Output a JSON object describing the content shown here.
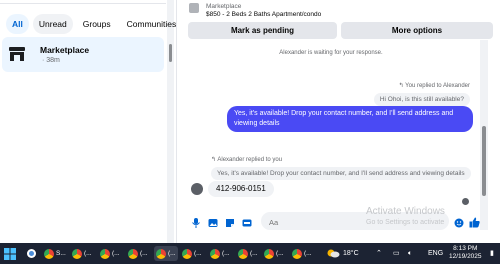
{
  "filters": [
    "All",
    "Unread",
    "Groups",
    "Communities"
  ],
  "chat_list": [
    {
      "title": "Marketplace",
      "subtitle": "· 38m"
    }
  ],
  "conversation": {
    "item_label": "Marketplace",
    "item_title": "$850 - 2 Beds 2 Baths Apartment/condo",
    "buttons": {
      "pending": "Mark as pending",
      "more": "More options"
    },
    "waiting_text": "Alexander is waiting for your response.",
    "reply_header_right": "You replied to Alexander",
    "quoted_right": "Hi Ohoi, is this still available?",
    "sent_message": "Yes, it's available! Drop your contact number, and I'll send address and viewing details",
    "reply_header_left": "Alexander replied to you",
    "quoted_left": "Yes, it's available! Drop your contact number, and I'll send address and viewing details",
    "received_message": "412-906-0151"
  },
  "composer": {
    "placeholder": "Aa"
  },
  "watermark": {
    "title": "Activate Windows",
    "subtitle": "Go to Settings to activate"
  },
  "taskbar": {
    "apps": [
      {
        "label": "S...",
        "color": "#e94b3c",
        "active": false
      },
      {
        "label": "(...",
        "color": "#e94b3c",
        "active": false
      },
      {
        "label": "(...",
        "color": "#e94b3c",
        "active": false
      },
      {
        "label": "(...",
        "color": "#e94b3c",
        "active": false
      },
      {
        "label": "(...",
        "color": "#e94b3c",
        "active": true
      },
      {
        "label": "(...",
        "color": "#e94b3c",
        "active": false
      },
      {
        "label": "(...",
        "color": "#e94b3c",
        "active": false
      },
      {
        "label": "(...",
        "color": "#e94b3c",
        "active": false
      },
      {
        "label": "(...",
        "color": "#e94b3c",
        "active": false
      },
      {
        "label": "(...",
        "color": "#e94b3c",
        "active": false
      }
    ],
    "temperature": "18°C",
    "language": "ENG",
    "time": "8:13 PM",
    "date": "12/19/2025"
  },
  "colors": {
    "accent": "#0064d1",
    "sent_bubble": "#4a4af4",
    "taskbar": "#1c2333"
  }
}
